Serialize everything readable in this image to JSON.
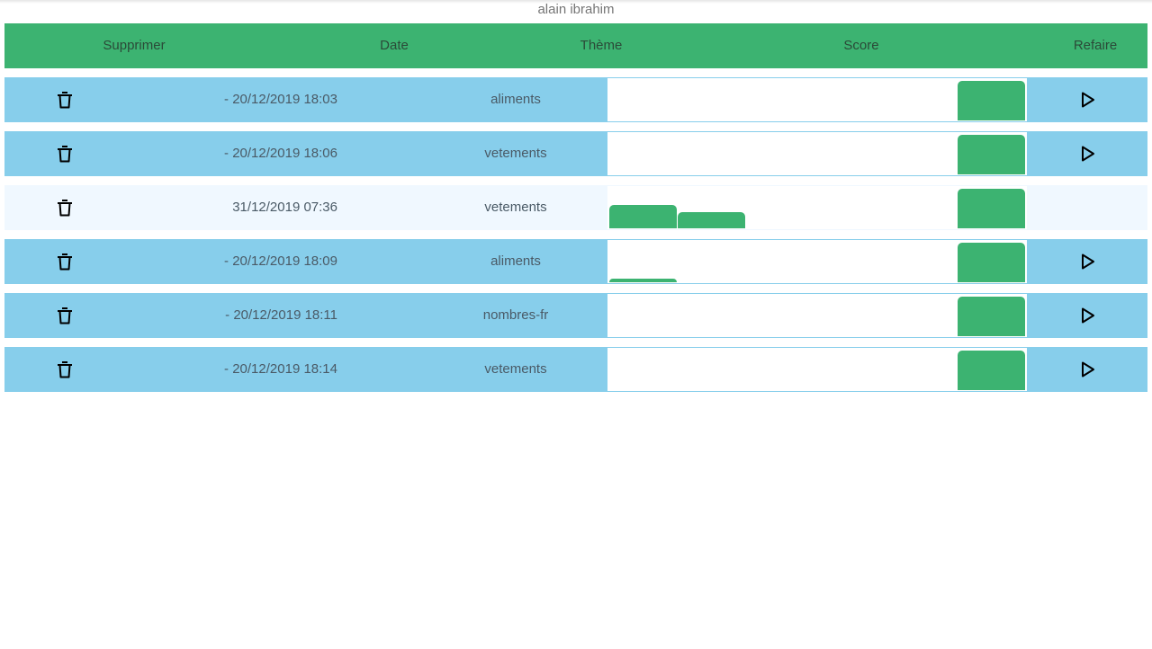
{
  "user": {
    "name": "alain ibrahim"
  },
  "header": {
    "delete": "Supprimer",
    "date": "Date",
    "theme": "Thème",
    "score": "Score",
    "redo": "Refaire"
  },
  "colors": {
    "header_bg": "#3cb371",
    "row_bg": "#87ceeb",
    "row_highlight_bg": "#f0f8ff",
    "bar": "#3cb371"
  },
  "rows": [
    {
      "date": "- 20/12/2019 18:03",
      "theme": "aliments",
      "highlight": false,
      "redo": true,
      "bars": [
        0,
        0,
        0,
        0,
        0,
        1
      ]
    },
    {
      "date": "- 20/12/2019 18:06",
      "theme": "vetements",
      "highlight": false,
      "redo": true,
      "bars": [
        0,
        0,
        0,
        0,
        0,
        1
      ]
    },
    {
      "date": "31/12/2019 07:36",
      "theme": "vetements",
      "highlight": true,
      "redo": false,
      "bars": [
        0.6,
        0.42,
        0,
        0,
        0,
        1
      ]
    },
    {
      "date": "- 20/12/2019 18:09",
      "theme": "aliments",
      "highlight": false,
      "redo": true,
      "bars": [
        0.1,
        0,
        0,
        0,
        0,
        1
      ]
    },
    {
      "date": "- 20/12/2019 18:11",
      "theme": "nombres-fr",
      "highlight": false,
      "redo": true,
      "bars": [
        0,
        0,
        0,
        0,
        0,
        1
      ]
    },
    {
      "date": "- 20/12/2019 18:14",
      "theme": "vetements",
      "highlight": false,
      "redo": true,
      "bars": [
        0,
        0,
        0,
        0,
        0,
        1
      ]
    }
  ]
}
